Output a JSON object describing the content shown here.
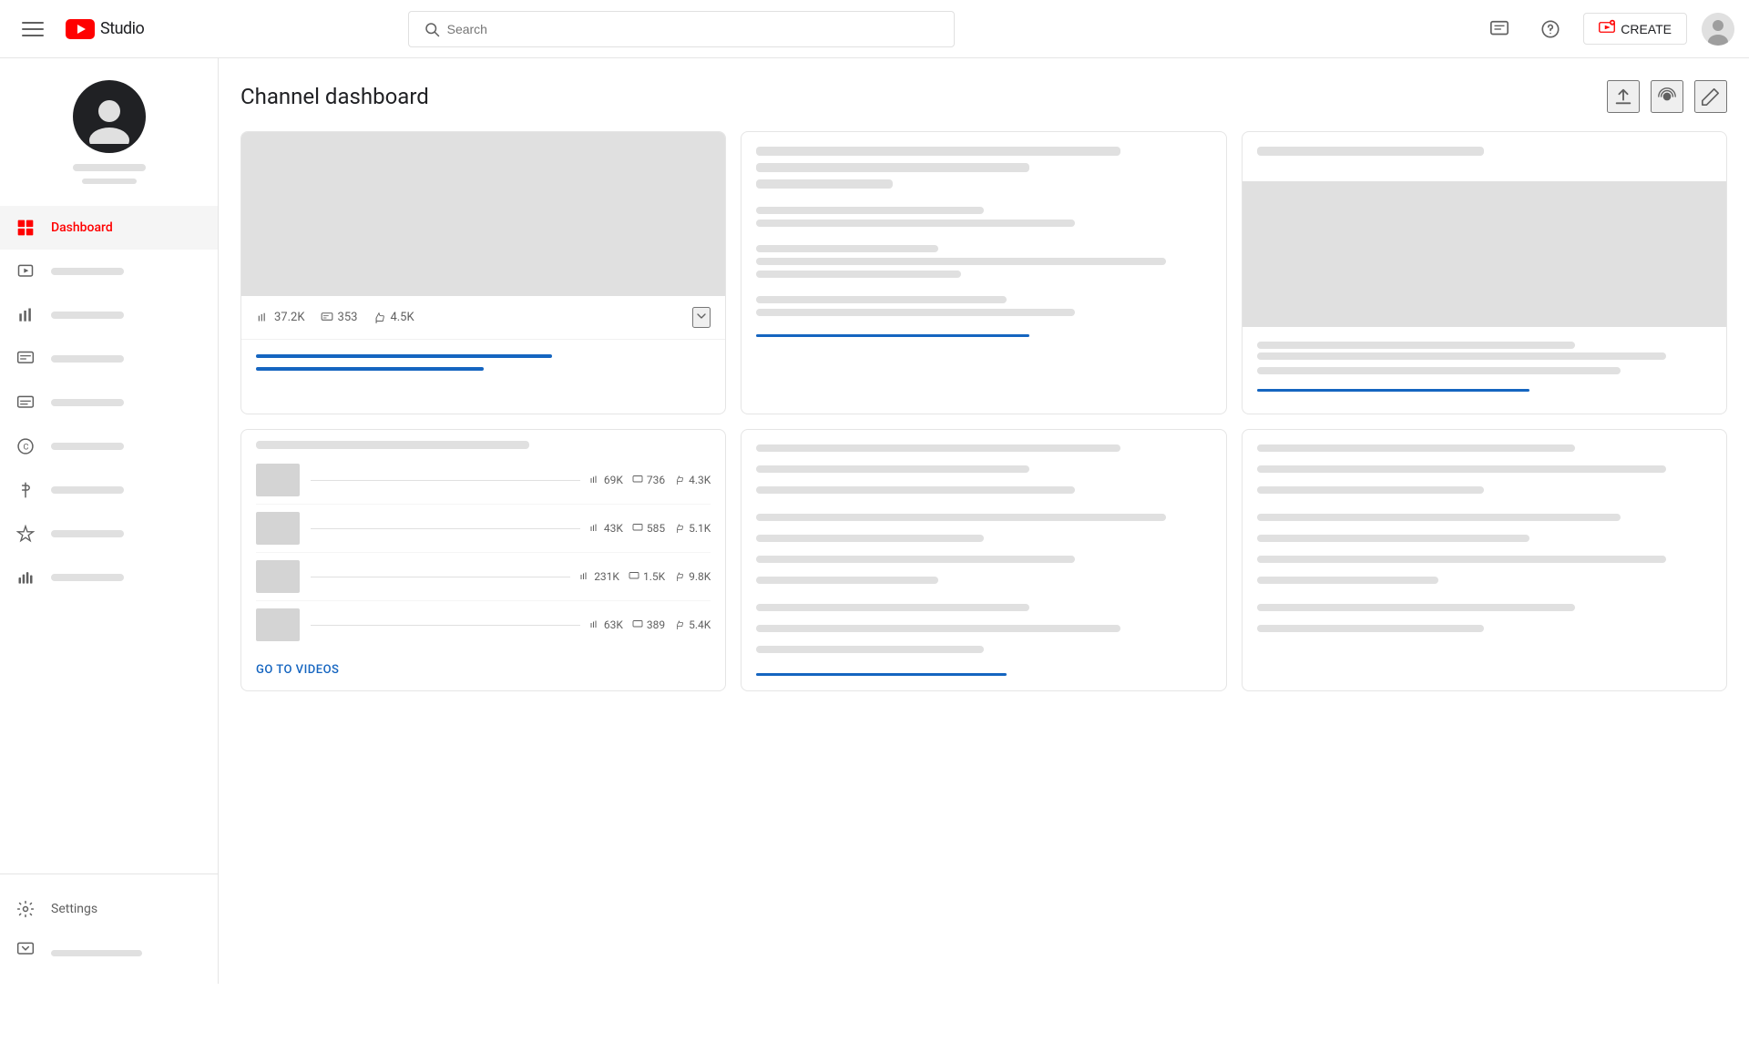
{
  "navbar": {
    "logo_text": "Studio",
    "search_placeholder": "Search",
    "create_label": "CREATE"
  },
  "sidebar": {
    "nav_items": [
      {
        "id": "dashboard",
        "label": "Dashboard",
        "active": true
      },
      {
        "id": "content",
        "label": "Content",
        "active": false
      },
      {
        "id": "analytics",
        "label": "Analytics",
        "active": false
      },
      {
        "id": "comments",
        "label": "Comments",
        "active": false
      },
      {
        "id": "subtitles",
        "label": "Subtitles",
        "active": false
      },
      {
        "id": "copyright",
        "label": "Copyright",
        "active": false
      },
      {
        "id": "monetization",
        "label": "Monetization",
        "active": false
      },
      {
        "id": "customization",
        "label": "Customization",
        "active": false
      },
      {
        "id": "audio",
        "label": "Audio Library",
        "active": false
      }
    ],
    "settings_label": "Settings",
    "send_feedback_label": "Send feedback"
  },
  "main": {
    "page_title": "Channel dashboard",
    "top_video": {
      "views": "37.2K",
      "comments": "353",
      "likes": "4.5K"
    },
    "video_list": {
      "items": [
        {
          "views": "69K",
          "comments": "736",
          "likes": "4.3K"
        },
        {
          "views": "43K",
          "comments": "585",
          "likes": "5.1K"
        },
        {
          "views": "231K",
          "comments": "1.5K",
          "likes": "9.8K"
        },
        {
          "views": "63K",
          "comments": "389",
          "likes": "5.4K"
        }
      ],
      "go_to_videos": "GO TO VIDEOS"
    }
  },
  "colors": {
    "accent_red": "#ff0000",
    "accent_blue": "#1565c0",
    "text_primary": "#202124",
    "text_secondary": "#606060",
    "border": "#e5e5e5",
    "placeholder_bg": "#e0e0e0"
  }
}
